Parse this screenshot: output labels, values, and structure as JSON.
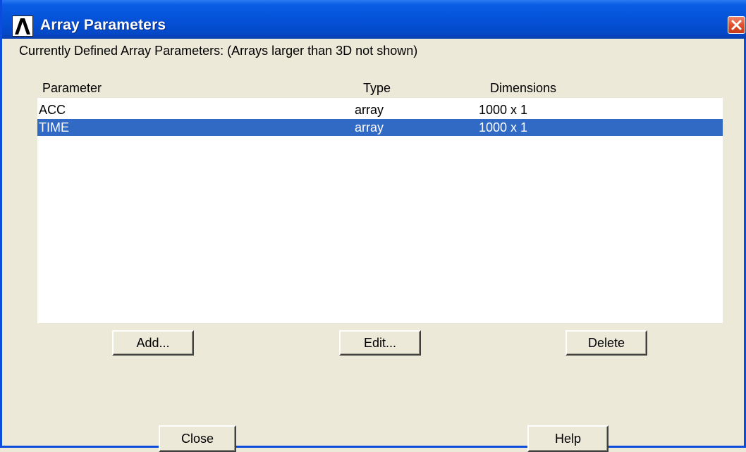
{
  "window": {
    "title": "Array Parameters",
    "accent_color": "#0a5ee4",
    "icons": {
      "app": "ansys-logo-icon",
      "close": "close-icon"
    }
  },
  "heading": "Currently Defined Array Parameters: (Arrays larger than 3D not shown)",
  "table": {
    "columns": [
      "Parameter",
      "Type",
      "Dimensions"
    ],
    "rows": [
      {
        "parameter": "ACC",
        "type": "array",
        "dimensions": "1000 x 1",
        "selected": false
      },
      {
        "parameter": "TIME",
        "type": "array",
        "dimensions": "1000 x 1",
        "selected": true
      }
    ],
    "selection_color": "#316ac5"
  },
  "buttons": {
    "add": "Add...",
    "edit": "Edit...",
    "delete": "Delete",
    "close": "Close",
    "help": "Help"
  }
}
